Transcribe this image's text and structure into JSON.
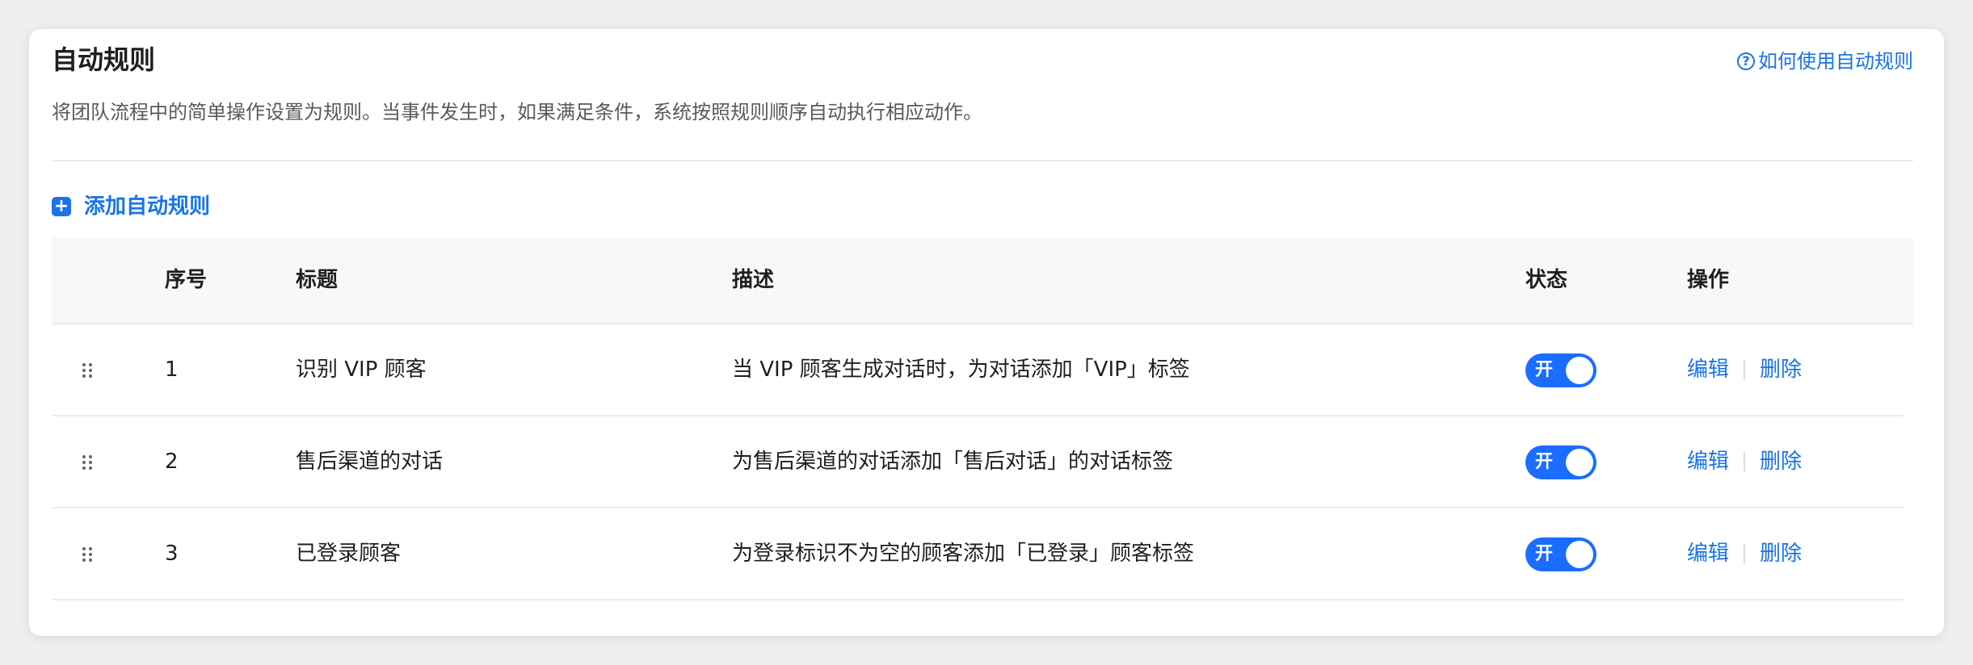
{
  "header": {
    "title": "自动规则",
    "help_icon": "question-circle-icon",
    "help_link": "如何使用自动规则",
    "subtitle": "将团队流程中的简单操作设置为规则。当事件发生时，如果满足条件，系统按照规则顺序自动执行相应动作。"
  },
  "add_rule": {
    "icon": "plus-square-icon",
    "label": "添加自动规则"
  },
  "table": {
    "columns": [
      "序号",
      "标题",
      "描述",
      "状态",
      "操作"
    ],
    "rows": [
      {
        "num": "1",
        "title": "识别 VIP 顾客",
        "desc": "当 VIP 顾客生成对话时，为对话添加「VIP」标签",
        "status_on": true,
        "status_label": "开",
        "edit": "编辑",
        "delete": "删除"
      },
      {
        "num": "2",
        "title": "售后渠道的对话",
        "desc": "为售后渠道的对话添加「售后对话」的对话标签",
        "status_on": true,
        "status_label": "开",
        "edit": "编辑",
        "delete": "删除"
      },
      {
        "num": "3",
        "title": "已登录顾客",
        "desc": "为登录标识不为空的顾客添加「已登录」顾客标签",
        "status_on": true,
        "status_label": "开",
        "edit": "编辑",
        "delete": "删除"
      }
    ]
  },
  "colors": {
    "accent": "#1a73e8",
    "toggle_on": "#1a6dff"
  }
}
